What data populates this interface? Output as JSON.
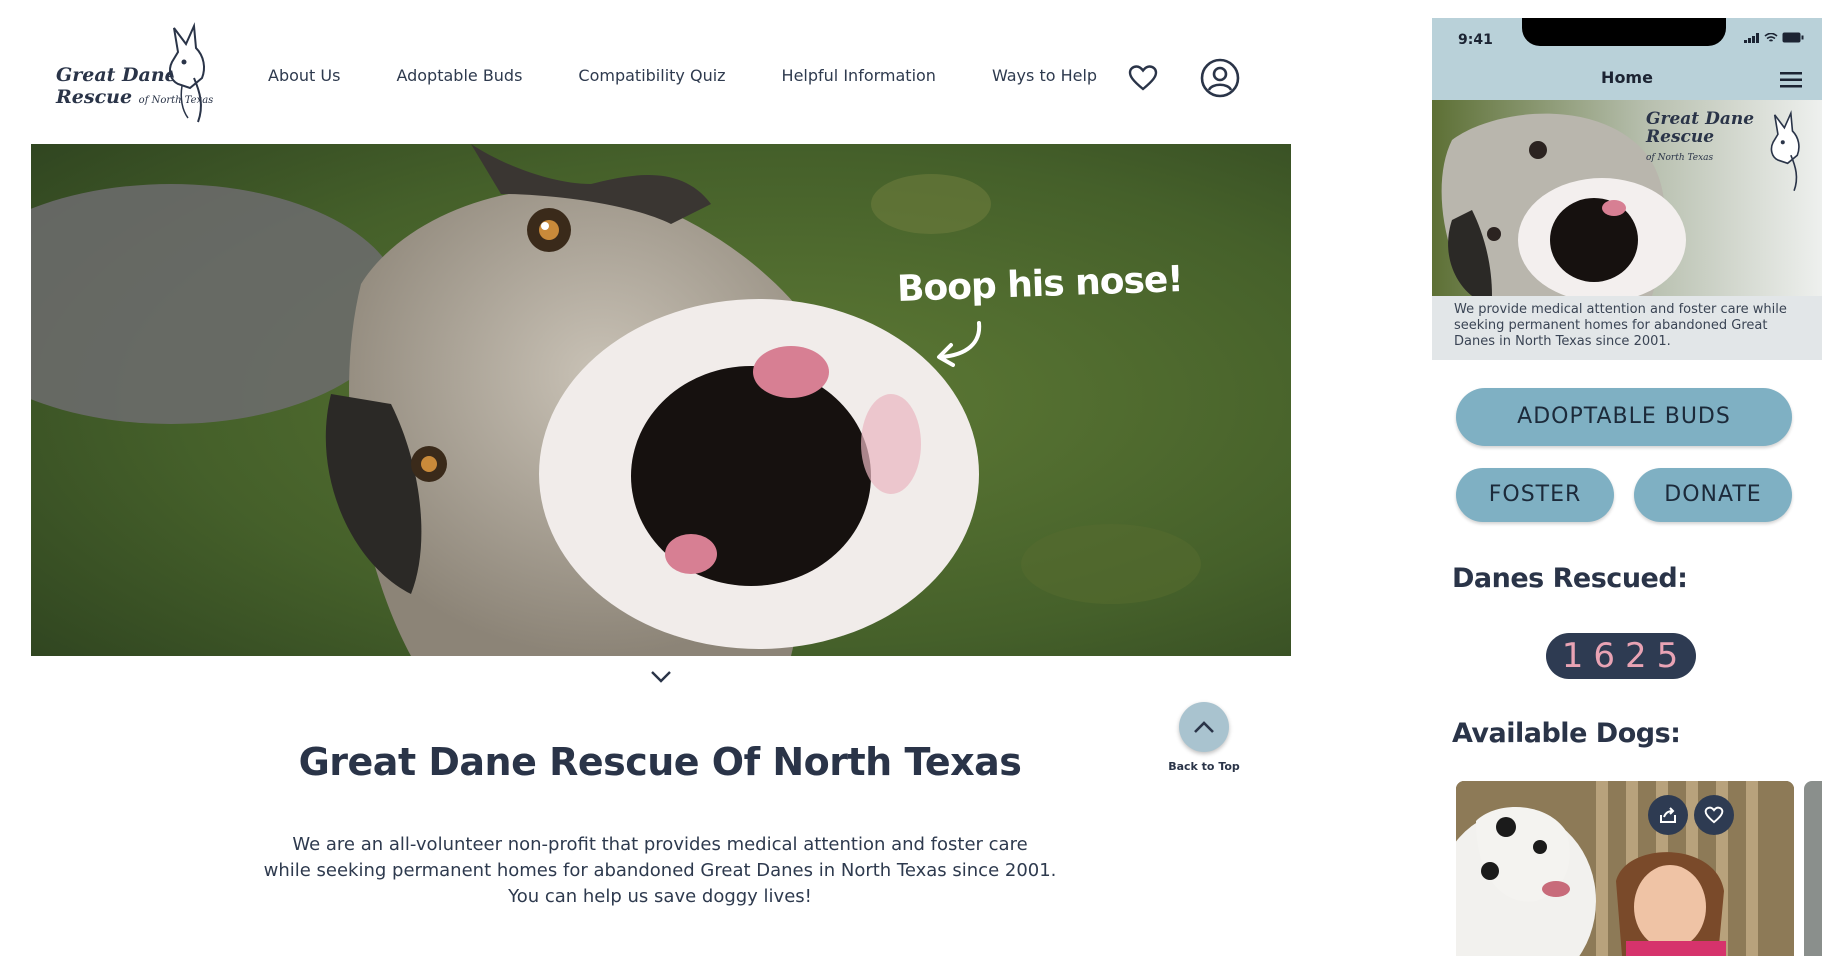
{
  "desktop": {
    "logo": {
      "line1": "Great Dane",
      "line2": "Rescue",
      "line3": "of North Texas"
    },
    "nav": [
      {
        "label": "About Us"
      },
      {
        "label": "Adoptable Buds"
      },
      {
        "label": "Compatibility Quiz"
      },
      {
        "label": "Helpful Information"
      },
      {
        "label": "Ways to Help"
      }
    ],
    "icons": {
      "favorites": "heart-icon",
      "account": "user-circle-icon",
      "scroll": "chevron-down-icon",
      "back_to_top": "chevron-up-icon"
    },
    "hero": {
      "overlay_text": "Boop his nose!"
    },
    "back_to_top_label": "Back to Top",
    "title": "Great Dane Rescue Of North Texas",
    "description": [
      "We are an all-volunteer non-profit that provides medical attention and foster care",
      "while seeking permanent homes for abandoned Great Danes in North Texas since 2001.",
      "You can help us save doggy lives!"
    ]
  },
  "mobile": {
    "status_time": "9:41",
    "header_title": "Home",
    "logo": {
      "line1": "Great Dane",
      "line2": "Rescue",
      "line3": "of North Texas"
    },
    "caption": "We provide medical attention and foster care while seeking permanent homes for abandoned Great Danes in North Texas since 2001.",
    "buttons": {
      "adoptable": "ADOPTABLE BUDS",
      "foster": "FOSTER",
      "donate": "DONATE"
    },
    "danes_rescued_heading": "Danes Rescued:",
    "danes_rescued_count": "1625",
    "available_heading": "Available Dogs:",
    "icons": {
      "menu": "hamburger-icon",
      "share": "share-icon",
      "favorite": "heart-icon"
    }
  },
  "colors": {
    "navy": "#2a3448",
    "button_blue": "#7fb0c3",
    "header_blue": "#b9d1d9",
    "counter_bg": "#2e3b52",
    "counter_text": "#e9a3b4"
  }
}
